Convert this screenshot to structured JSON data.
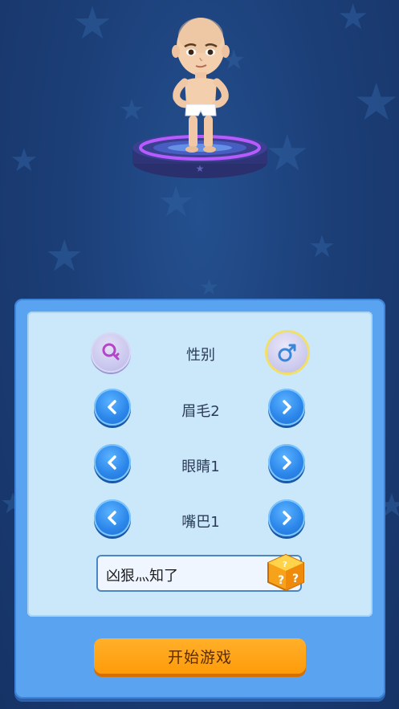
{
  "customizer": {
    "gender_label": "性别",
    "eyebrow_label": "眉毛2",
    "eyes_label": "眼睛1",
    "mouth_label": "嘴巴1",
    "name_value": "凶狠灬知了",
    "start_label": "开始游戏"
  },
  "icons": {
    "female": "female-symbol-icon",
    "male": "male-symbol-icon",
    "prev": "chevron-left-icon",
    "next": "chevron-right-icon",
    "random": "random-dice-icon"
  },
  "colors": {
    "background": "#1c3f78",
    "panel": "#5aa3f0",
    "panel_inner": "#cbe8fb",
    "button_blue": "#2c86ea",
    "start_orange": "#ff9b0a",
    "selected_ring": "#f2df67"
  }
}
